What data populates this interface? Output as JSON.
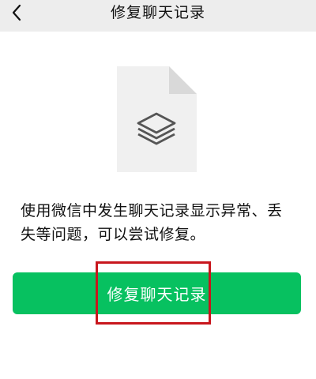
{
  "nav": {
    "title": "修复聊天记录",
    "back_icon": "chevron-left-icon"
  },
  "illustration": {
    "icon": "document-layers-icon",
    "page_color": "#f0f0f0",
    "fold_color": "#d9d9d9",
    "layers_color": "#555555"
  },
  "description": {
    "line1": "使用微信中发生聊天记录显示异常、丢",
    "line2": "失等问题，可以尝试修复。"
  },
  "action": {
    "label": "修复聊天记录",
    "color": "#07c160"
  },
  "annotation": {
    "color": "#c8161d"
  }
}
